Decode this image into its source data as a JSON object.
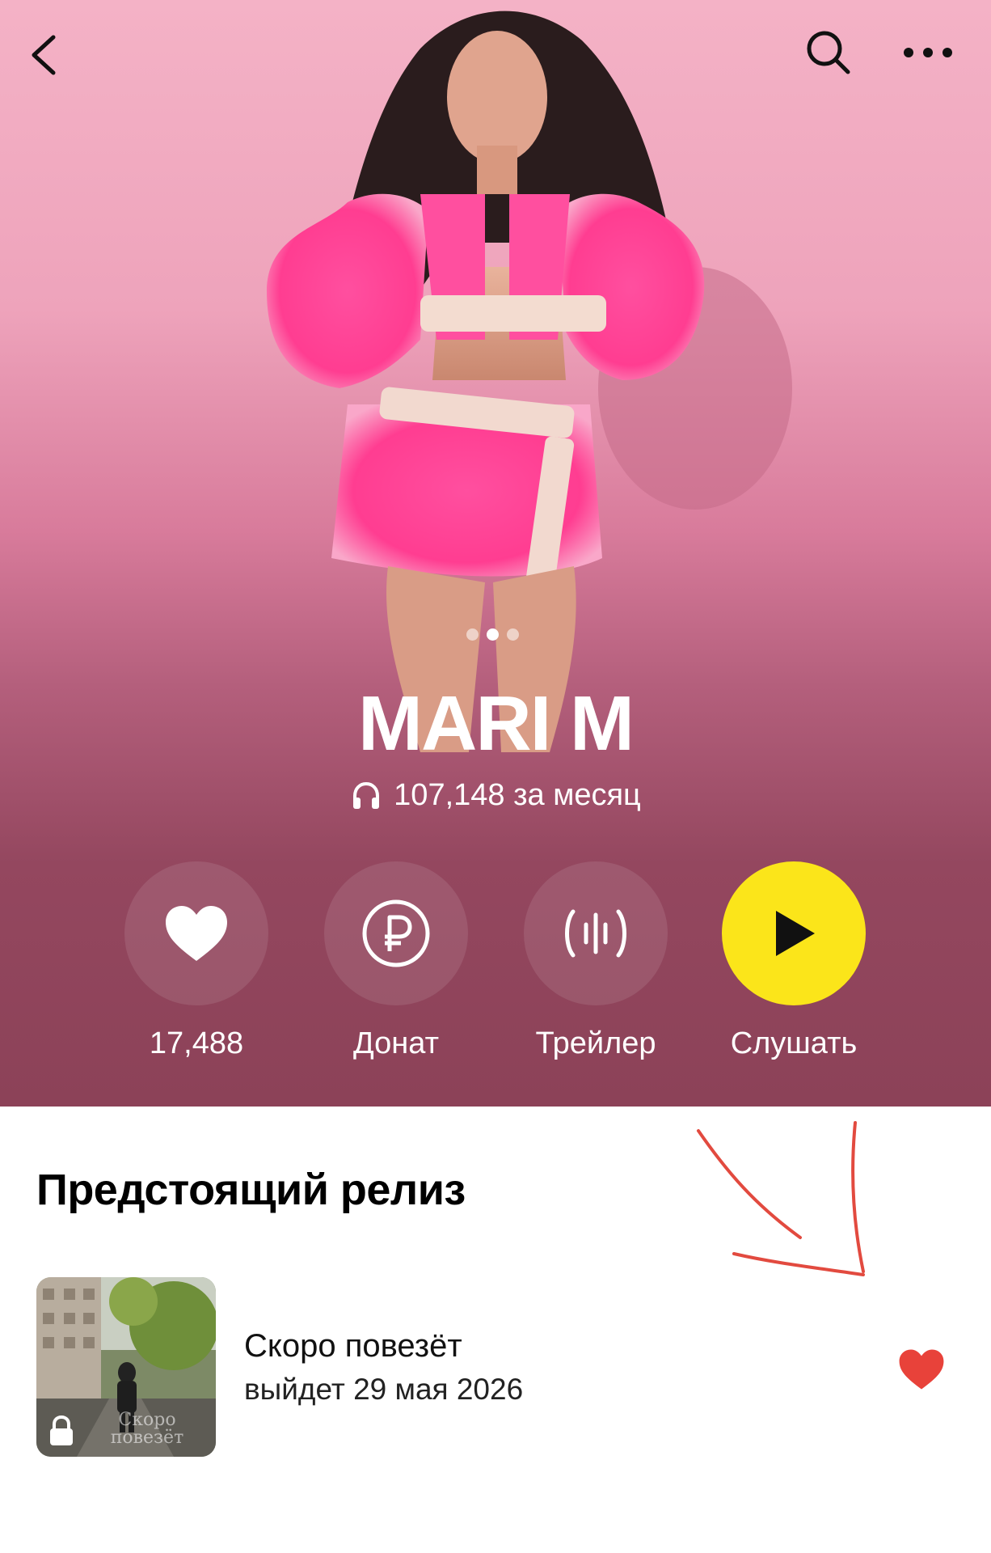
{
  "header": {
    "back_icon": "chevron-left-icon",
    "search_icon": "search-icon",
    "more_icon": "more-horizontal-icon"
  },
  "gallery": {
    "pages": 3,
    "active_page": 2
  },
  "artist": {
    "name": "MARI M",
    "listeners_icon": "headphones-icon",
    "monthly_listeners": "107,148 за месяц"
  },
  "actions": [
    {
      "id": "like",
      "icon": "heart-icon",
      "label": "17,488"
    },
    {
      "id": "donate",
      "icon": "ruble-icon",
      "label": "Донат"
    },
    {
      "id": "trailer",
      "icon": "waveform-icon",
      "label": "Трейлер"
    },
    {
      "id": "listen",
      "icon": "play-icon",
      "label": "Слушать"
    }
  ],
  "upcoming": {
    "section_title": "Предстоящий релиз",
    "title": "Скоро повезёт",
    "release_date": "выйдет 29 мая 2026",
    "cover_text": "Скоро повезёт",
    "lock_icon": "lock-icon",
    "like_icon": "heart-icon",
    "liked": true
  },
  "colors": {
    "hero_top": "#f4b2c6",
    "hero_bottom": "#8c4258",
    "play_button": "#fbe51a",
    "like_red": "#e8423a",
    "annotation_red": "#e24a3f"
  }
}
